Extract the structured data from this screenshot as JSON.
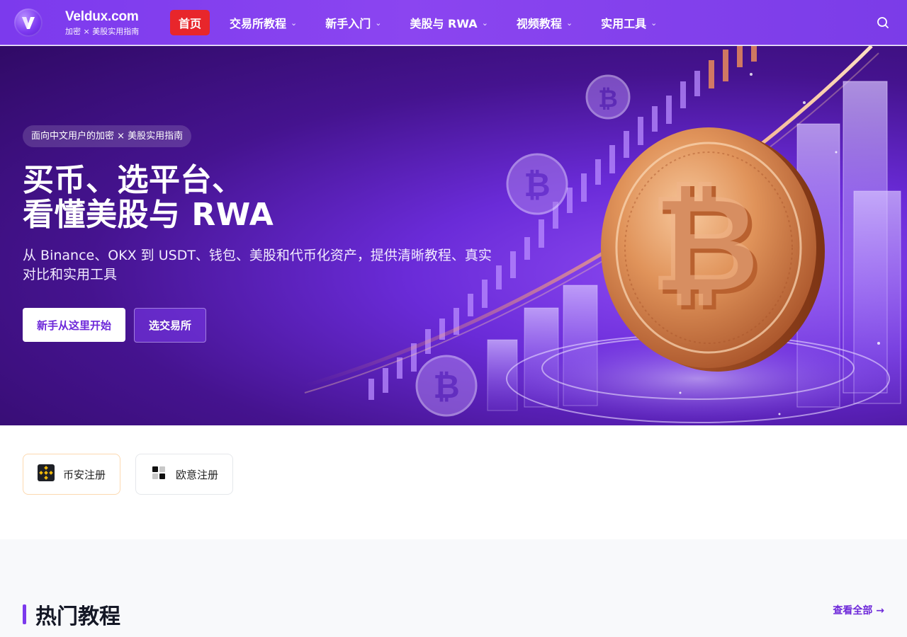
{
  "header": {
    "brand_name": "Veldux.com",
    "brand_tagline": "加密 × 美股实用指南",
    "nav": [
      {
        "label": "首页",
        "active": true
      },
      {
        "label": "交易所教程",
        "dropdown": true
      },
      {
        "label": "新手入门",
        "dropdown": true
      },
      {
        "label": "美股与 RWA",
        "dropdown": true
      },
      {
        "label": "视频教程",
        "dropdown": true
      },
      {
        "label": "实用工具",
        "dropdown": true
      }
    ],
    "search_icon": "search-icon"
  },
  "hero": {
    "pill": "面向中文用户的加密 × 美股实用指南",
    "title_line1": "买币、选平台、",
    "title_line2": "看懂美股与 RWA",
    "subtitle": "从 Binance、OKX 到 USDT、钱包、美股和代币化资产，提供清晰教程、真实对比和实用工具",
    "primary_cta": "新手从这里开始",
    "secondary_cta": "选交易所",
    "coin_symbol": "₿"
  },
  "register": {
    "binance": {
      "label": "币安注册",
      "icon": "binance-icon"
    },
    "okx": {
      "label": "欧意注册",
      "icon": "okx-icon"
    }
  },
  "hot": {
    "title": "热门教程",
    "view_all": "查看全部 →"
  },
  "colors": {
    "brand_purple": "#7c3aed",
    "active_nav_red": "#e8262b",
    "binance_yellow": "#f0b90b"
  }
}
